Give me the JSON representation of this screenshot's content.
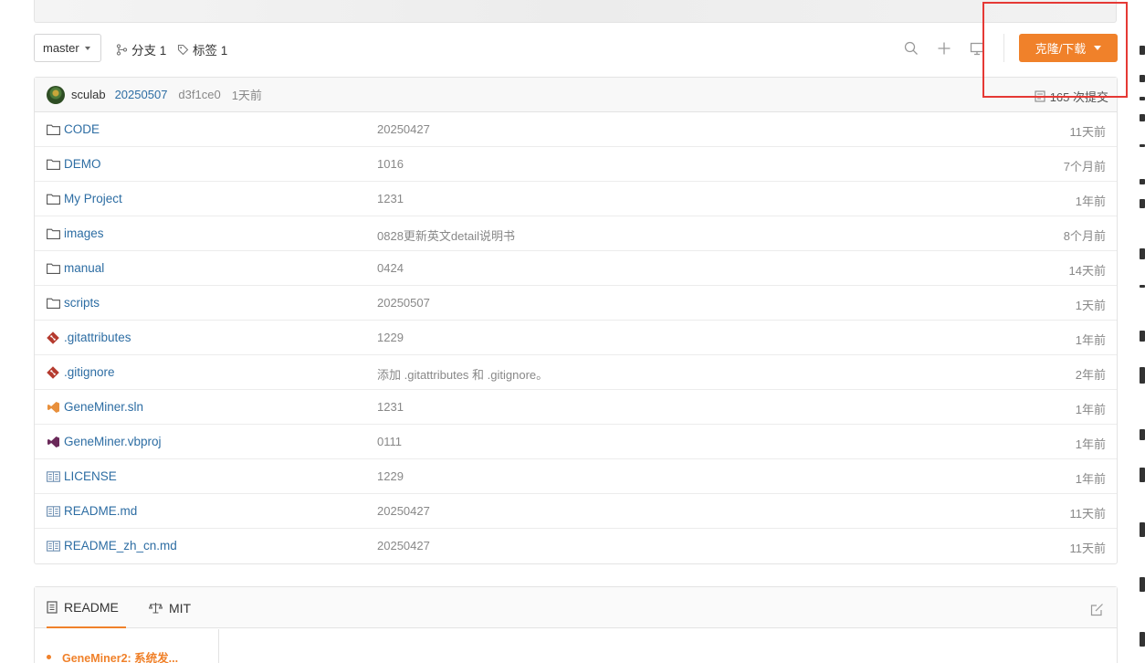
{
  "toolbar": {
    "branch": "master",
    "branches_label": "分支 1",
    "tags_label": "标签 1",
    "clone_label": "克隆/下载"
  },
  "commit": {
    "author": "sculab",
    "message": "20250507",
    "sha": "d3f1ce0",
    "time": "1天前",
    "count_label": "165 次提交"
  },
  "files": [
    {
      "name": "CODE",
      "type": "folder",
      "commit": "20250427",
      "time": "11天前"
    },
    {
      "name": "DEMO",
      "type": "folder",
      "commit": "1016",
      "time": "7个月前"
    },
    {
      "name": "My Project",
      "type": "folder",
      "commit": "1231",
      "time": "1年前"
    },
    {
      "name": "images",
      "type": "folder",
      "commit": "0828更新英文detail说明书",
      "time": "8个月前"
    },
    {
      "name": "manual",
      "type": "folder",
      "commit": "0424",
      "time": "14天前"
    },
    {
      "name": "scripts",
      "type": "folder",
      "commit": "20250507",
      "time": "1天前"
    },
    {
      "name": ".gitattributes",
      "type": "git",
      "commit": "1229",
      "time": "1年前"
    },
    {
      "name": ".gitignore",
      "type": "git",
      "commit": "添加 .gitattributes 和 .gitignore。",
      "time": "2年前"
    },
    {
      "name": "GeneMiner.sln",
      "type": "vs-orange",
      "commit": "1231",
      "time": "1年前"
    },
    {
      "name": "GeneMiner.vbproj",
      "type": "vs-purple",
      "commit": "0111",
      "time": "1年前"
    },
    {
      "name": "LICENSE",
      "type": "doc",
      "commit": "1229",
      "time": "1年前"
    },
    {
      "name": "README.md",
      "type": "doc",
      "commit": "20250427",
      "time": "11天前"
    },
    {
      "name": "README_zh_cn.md",
      "type": "doc",
      "commit": "20250427",
      "time": "11天前"
    }
  ],
  "readme": {
    "tab_readme": "README",
    "tab_license": "MIT",
    "toc_first": "GeneMiner2: 系统发..."
  },
  "colors": {
    "accent": "#f0812a",
    "link": "#2d6da3",
    "highlight": "#e53935"
  }
}
